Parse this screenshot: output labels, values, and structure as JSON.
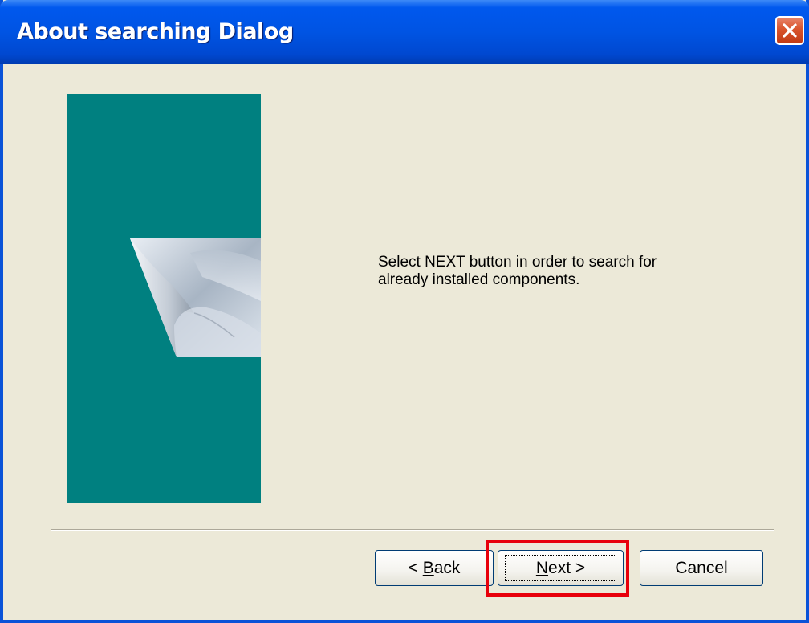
{
  "window": {
    "title": "About searching Dialog"
  },
  "titlebar": {
    "close_icon": "close-icon"
  },
  "banner": {
    "color": "#008080",
    "icon": "paper-curl-icon"
  },
  "message": {
    "line1": "Select NEXT button in order to search for",
    "line2": "already installed components."
  },
  "buttons": {
    "back": {
      "prefix": "< ",
      "mnemonic": "B",
      "rest": "ack"
    },
    "next": {
      "mnemonic": "N",
      "rest": "ext >"
    },
    "cancel": {
      "label": "Cancel"
    }
  },
  "highlight": {
    "color": "#e8000b",
    "target": "next-button"
  }
}
